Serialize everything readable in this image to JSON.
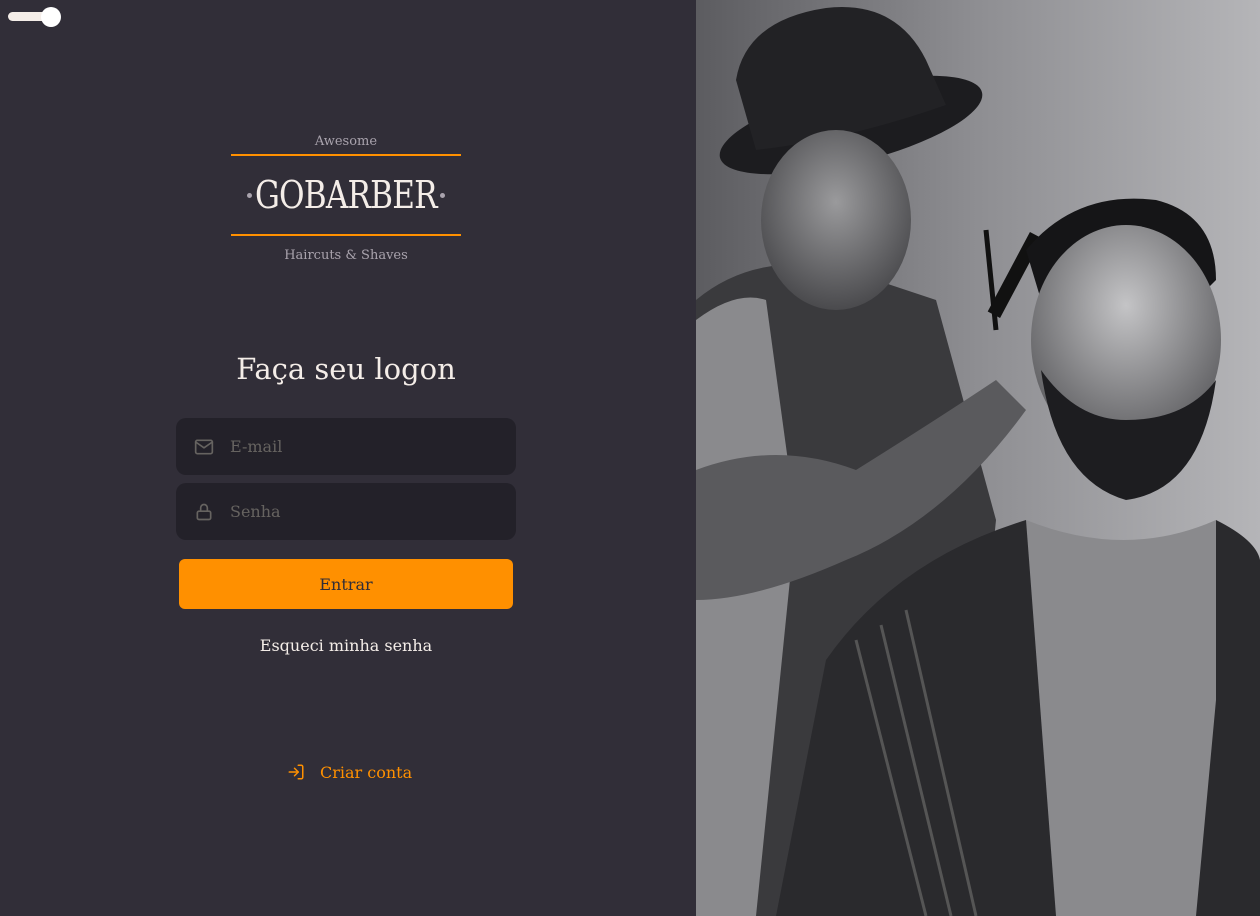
{
  "theme_toggle": {
    "state": "dark"
  },
  "logo": {
    "tagline_top": "Awesome",
    "wordmark": "GOBARBER",
    "tagline_bottom": "Haircuts & Shaves"
  },
  "form": {
    "title": "Faça seu logon",
    "email": {
      "placeholder": "E-mail",
      "value": "",
      "icon": "mail-icon"
    },
    "password": {
      "placeholder": "Senha",
      "value": "",
      "icon": "lock-icon"
    },
    "submit_label": "Entrar",
    "forgot_label": "Esqueci minha senha"
  },
  "create_account": {
    "label": "Criar conta",
    "icon": "log-in-icon"
  },
  "hero_image": {
    "icon": "barber-photo"
  },
  "colors": {
    "background": "#312e38",
    "input_background": "#232129",
    "accent": "#ff9000",
    "text": "#f4ede8",
    "muted": "#666360"
  }
}
